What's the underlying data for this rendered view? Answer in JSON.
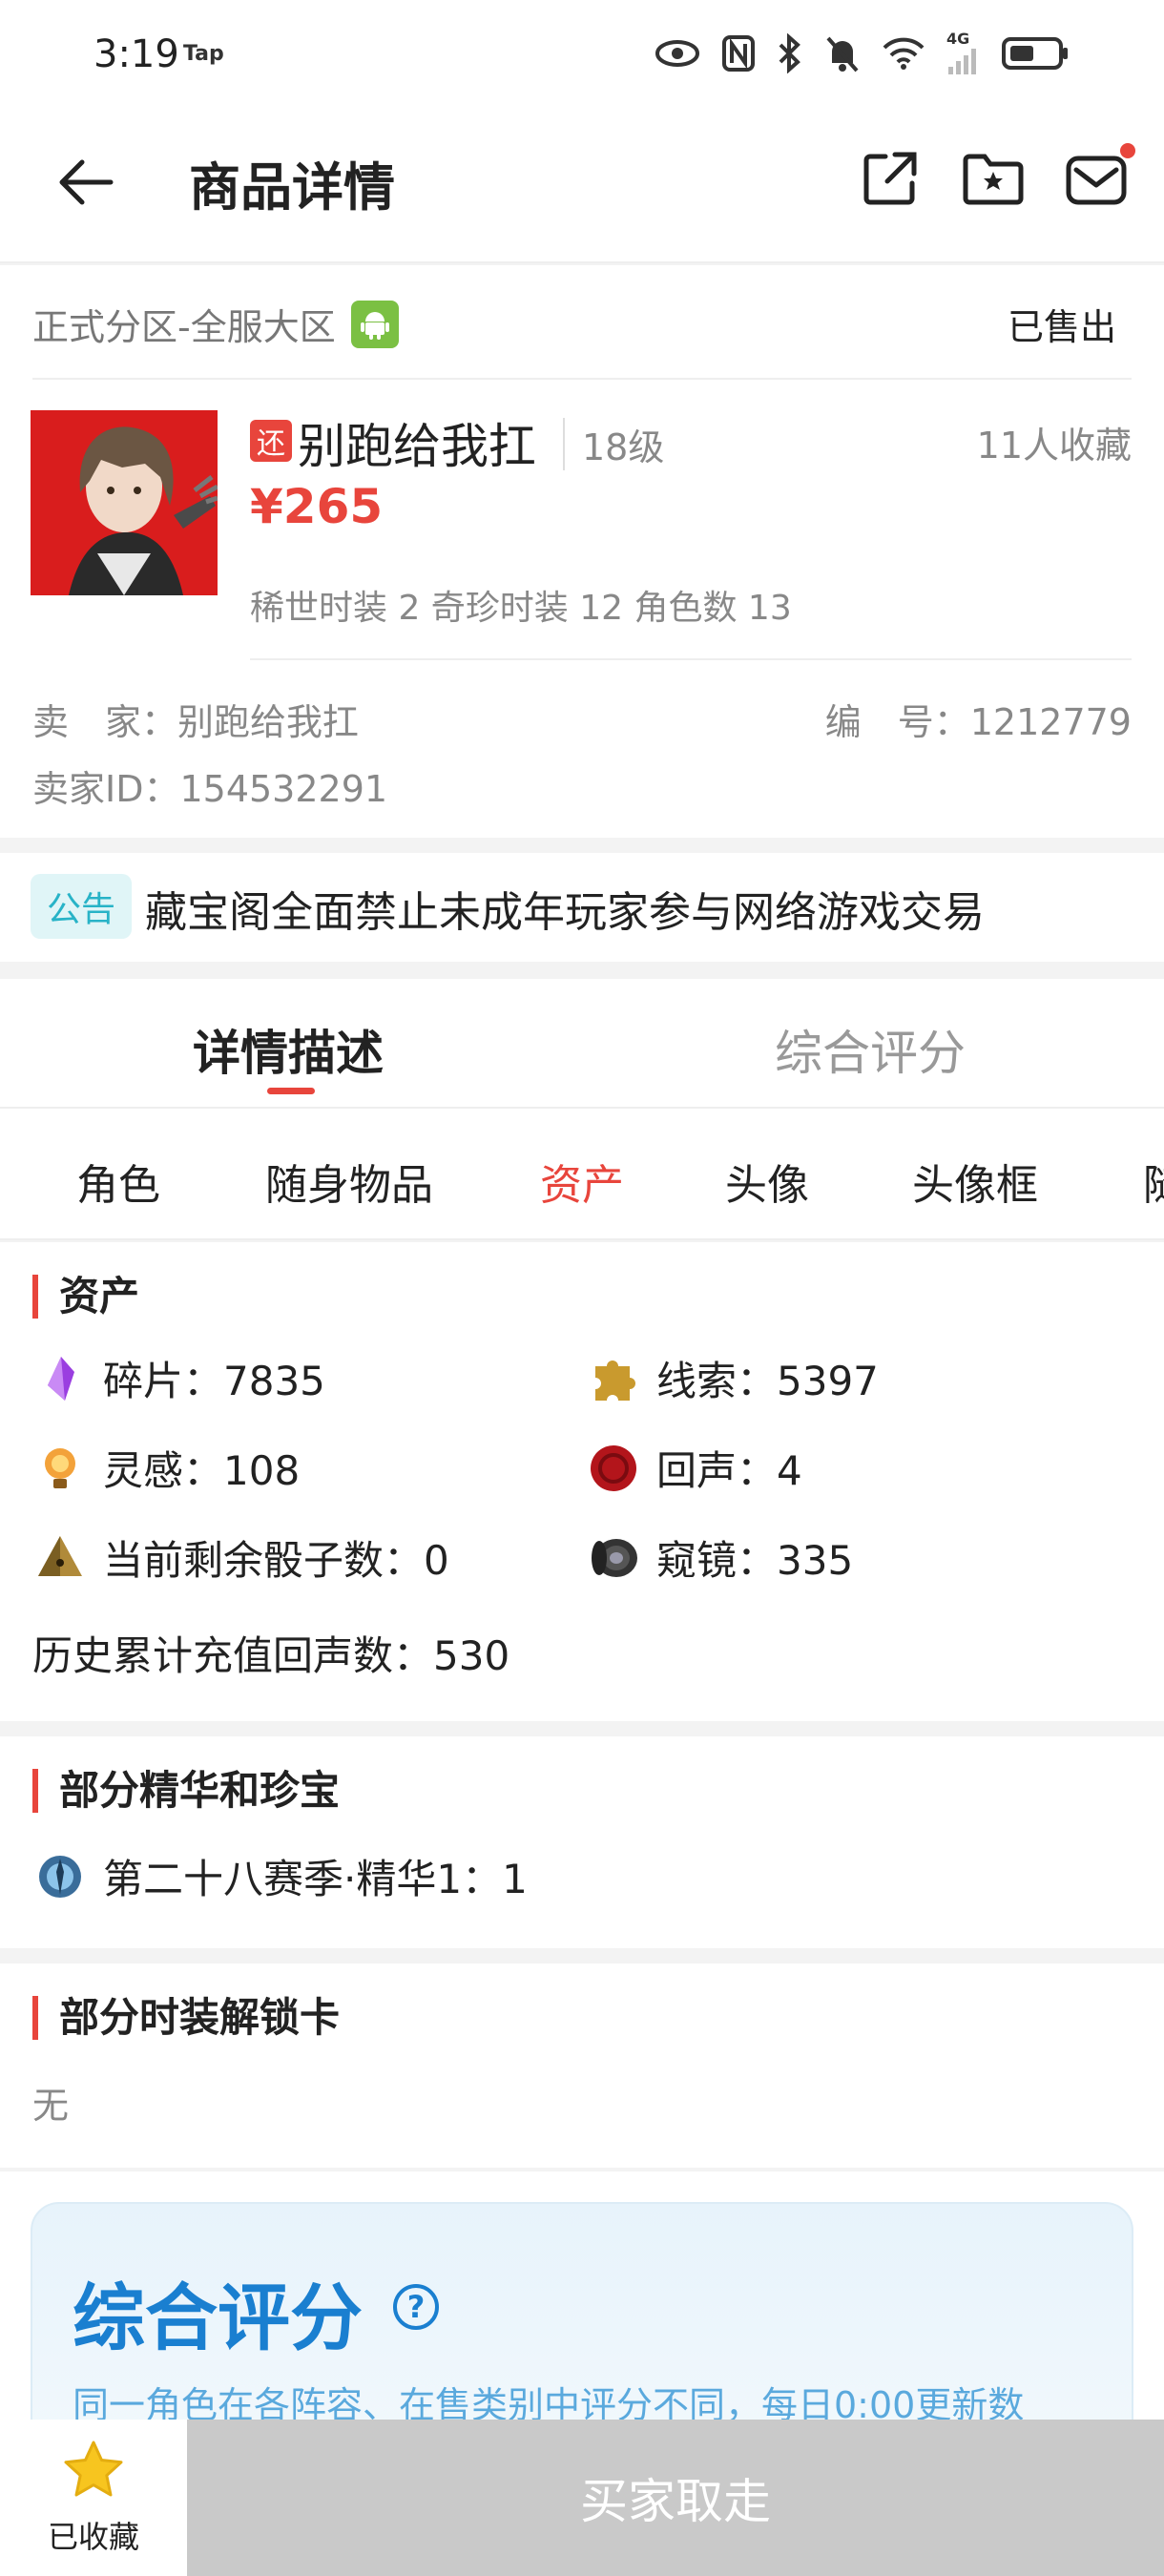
{
  "status_bar": {
    "time": "3:19",
    "tap": "Tap",
    "network": "4G"
  },
  "nav": {
    "title": "商品详情"
  },
  "product": {
    "zone": "正式分区-全服大区",
    "status": "已售出",
    "badge": "还",
    "name": "别跑给我扛",
    "level": "18级",
    "favorites": "11人收藏",
    "price": "¥265",
    "stats": "稀世时装 2 奇珍时装 12 角色数 13",
    "seller": "卖　家：别跑给我扛",
    "serial": "编　号：1212779",
    "seller_id": "卖家ID：154532291"
  },
  "notice": {
    "tag": "公告",
    "text": "藏宝阁全面禁止未成年玩家参与网络游戏交易"
  },
  "tabs": {
    "detail": "详情描述",
    "score": "综合评分"
  },
  "subtabs": [
    "角色",
    "随身物品",
    "资产",
    "头像",
    "头像框",
    "随"
  ],
  "assets": {
    "heading": "资产",
    "fragments": "碎片：7835",
    "clues": "线索：5397",
    "inspiration": "灵感：108",
    "echo": "回声：4",
    "dice": "当前剩余骰子数：0",
    "lens": "窥镜：335",
    "history": "历史累计充值回声数：530"
  },
  "essence": {
    "heading": "部分精华和珍宝",
    "item": "第二十八赛季·精华1：1"
  },
  "unlock": {
    "heading": "部分时装解锁卡",
    "value": "无"
  },
  "score_card": {
    "title": "综合评分",
    "help": "?",
    "desc": "同一角色在各阵容、在售类别中评分不同，每日0:00更新数"
  },
  "bottom": {
    "fav_label": "已收藏",
    "buy_label": "买家取走"
  },
  "colors": {
    "accent": "#e8453c",
    "blue": "#1a7fd0",
    "teal": "#28b3c7"
  }
}
